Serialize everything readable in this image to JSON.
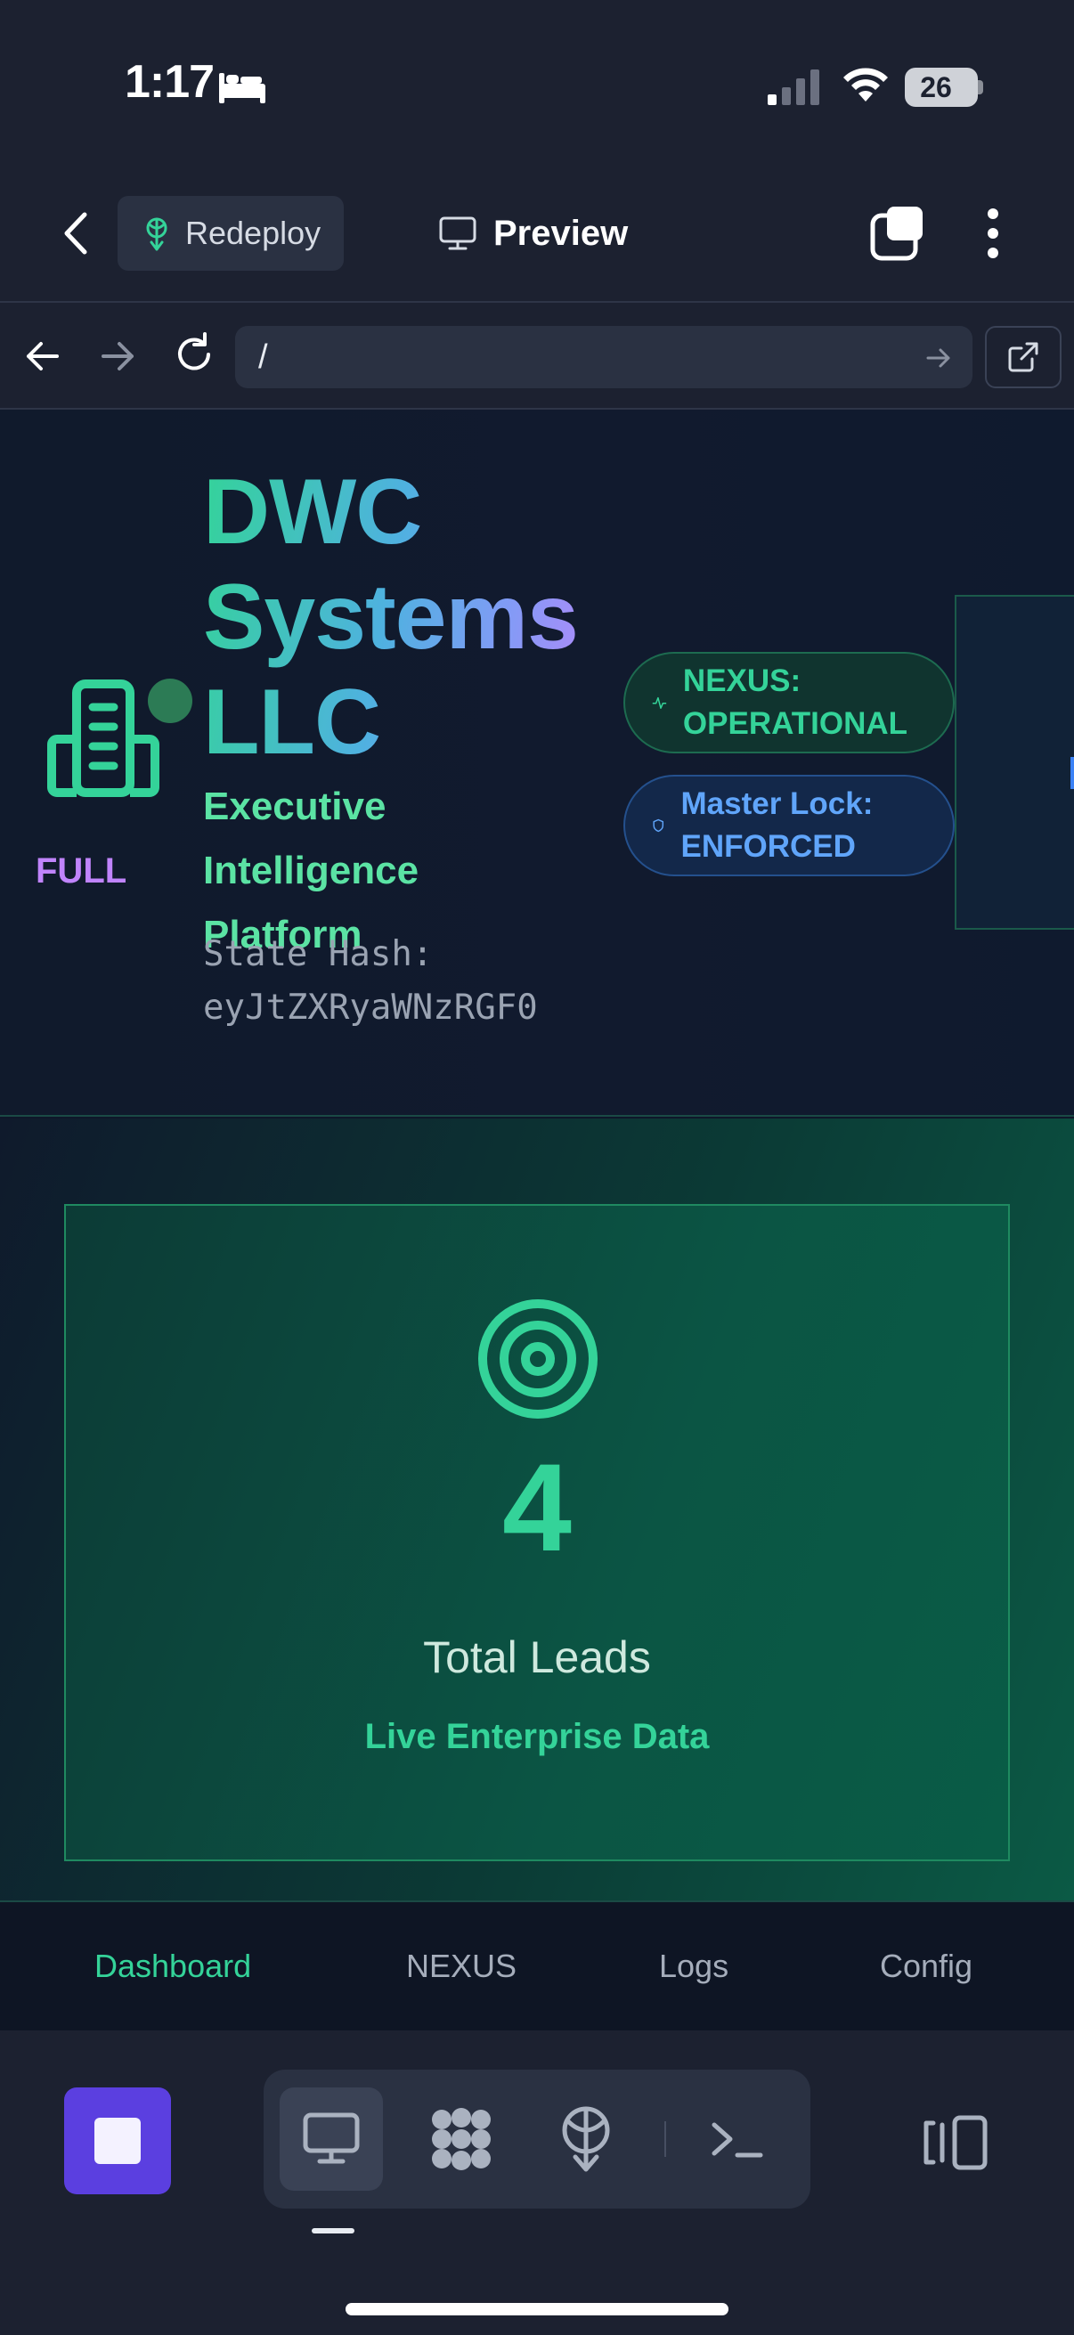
{
  "status_bar": {
    "time": "1:17",
    "battery": "26"
  },
  "toolbar": {
    "redeploy_label": "Redeploy",
    "preview_label": "Preview"
  },
  "address_bar": {
    "url": "/"
  },
  "header": {
    "company_name": "DWC Systems LLC",
    "tagline": "Executive Intelligence Platform",
    "state_hash": "State Hash: eyJtZXRyaWNzRGF0",
    "nexus_status": "NEXUS: OPERATIONAL",
    "master_lock": "Master Lock: ENFORCED",
    "side_card_label": "FULL"
  },
  "metrics": {
    "lead_count": "4",
    "lead_label": "Total Leads",
    "lead_sub": "Live Enterprise Data"
  },
  "web_tabs": {
    "dashboard": "Dashboard",
    "nexus": "NEXUS",
    "logs": "Logs",
    "config": "Config",
    "active": "Dashboard"
  },
  "colors": {
    "accent_green": "#34d399",
    "accent_blue": "#60a5fa",
    "accent_purple": "#c084fc",
    "stop_button": "#5b3fe0"
  },
  "icons": [
    "bed-icon",
    "signal-icon",
    "wifi-icon",
    "chevron-left-icon",
    "redeploy-icon",
    "monitor-icon",
    "tabs-icon",
    "more-vertical-icon",
    "arrow-left-icon",
    "arrow-right-icon",
    "reload-icon",
    "go-arrow-icon",
    "external-link-icon",
    "building-icon",
    "activity-icon",
    "shield-icon",
    "target-icon",
    "stop-icon",
    "workspace-icon",
    "deploy-icon",
    "terminal-icon",
    "panel-toggle-icon"
  ]
}
